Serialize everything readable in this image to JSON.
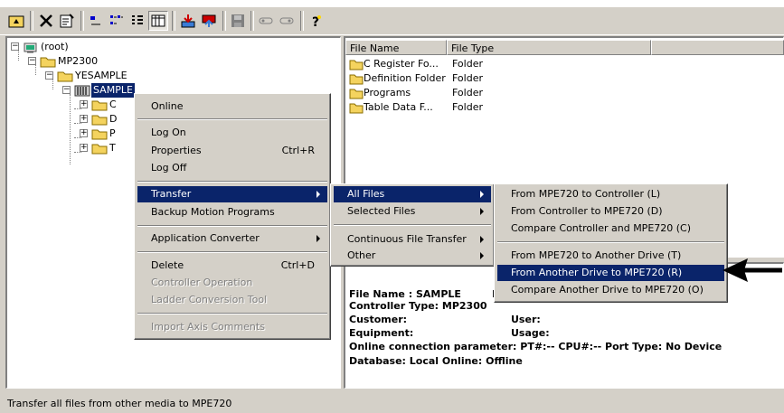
{
  "tree": {
    "root": "(root)",
    "controller": "MP2300",
    "project": "YESAMPLE",
    "selected": "SAMPLE",
    "children": [
      "C",
      "D",
      "P",
      "T"
    ]
  },
  "file_list": {
    "columns": [
      "File Name",
      "File Type"
    ],
    "rows": [
      {
        "name": "C Register Fo...",
        "type": "Folder"
      },
      {
        "name": "Definition Folder",
        "type": "Folder"
      },
      {
        "name": "Programs",
        "type": "Folder"
      },
      {
        "name": "Table Data F...",
        "type": "Folder"
      }
    ]
  },
  "info_panel": {
    "file_name": "File Name : SAMPLE",
    "file_name_suffix": "I",
    "controller_type": "Controller Type: MP2300",
    "customer": "Customer:",
    "user": "User:",
    "equipment": "Equipment:",
    "usage": "Usage:",
    "online_param": "Online connection parameter: PT#:-- CPU#:--     Port Type: No Device",
    "database": "Database: Local  Online: Offline"
  },
  "context_menu": {
    "online": "Online",
    "log_on": "Log On",
    "properties": "Properties",
    "properties_shortcut": "Ctrl+R",
    "log_off": "Log Off",
    "transfer": "Transfer",
    "backup": "Backup Motion Programs",
    "app_converter": "Application Converter",
    "delete": "Delete",
    "delete_shortcut": "Ctrl+D",
    "controller_operation": "Controller Operation",
    "ladder_conversion": "Ladder Conversion Tool",
    "import_axis": "Import Axis Comments"
  },
  "transfer_menu": {
    "all_files": "All Files",
    "selected_files": "Selected Files",
    "continuous": "Continuous File Transfer",
    "other": "Other"
  },
  "all_files_menu": {
    "items": [
      "From MPE720 to Controller (L)",
      "From Controller to MPE720 (D)",
      "Compare Controller and MPE720 (C)",
      "From MPE720 to Another Drive (T)",
      "From Another Drive to MPE720 (R)",
      "Compare Another Drive to MPE720 (O)"
    ]
  },
  "status_bar": {
    "text": "Transfer all files from other media to MPE720"
  },
  "colors": {
    "face": "#d4d0c8",
    "highlight": "#0a246a",
    "folder": "#f4d35e"
  }
}
